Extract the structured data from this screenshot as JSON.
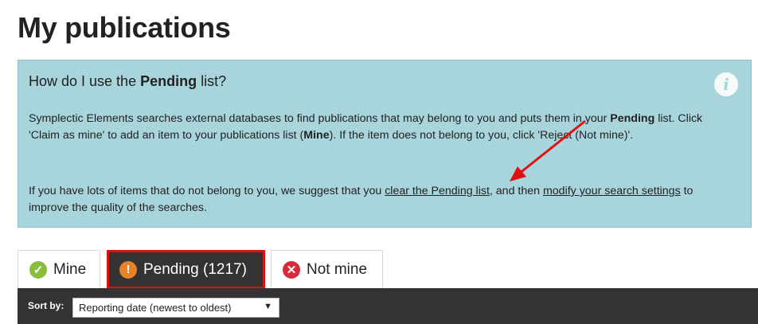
{
  "page": {
    "title": "My publications"
  },
  "help": {
    "heading_prefix": "How do I use the ",
    "heading_bold": "Pending",
    "heading_suffix": " list?",
    "p1_a": "Symplectic Elements searches external databases to find publications that may belong to you and puts them in your ",
    "p1_b_bold": "Pending",
    "p1_c": " list. Click 'Claim as mine' to add an item to your publications list (",
    "p1_d_bold": "Mine",
    "p1_e": "). If the item does not belong to you, click 'Reject (Not mine)'.",
    "p2_a": "If you have lots of items that do not belong to you, we suggest that you ",
    "p2_link1": "clear the Pending list",
    "p2_b": ", and then ",
    "p2_link2": "modify your search settings",
    "p2_c": " to improve the quality of the searches."
  },
  "tabs": [
    {
      "label": "Mine",
      "icon": "check-circle-icon"
    },
    {
      "label": "Pending (1217)",
      "icon": "exclamation-circle-icon",
      "active": true
    },
    {
      "label": "Not mine",
      "icon": "x-circle-icon"
    }
  ],
  "toolbar": {
    "sort_label": "Sort by:",
    "sort_value": "Reporting date (newest to oldest)"
  },
  "colors": {
    "help_bg": "#a8d4dc",
    "toolbar_bg": "#333333",
    "highlight": "#e01010",
    "mine_icon": "#8bbd3c",
    "pending_icon": "#e8822a",
    "notmine_icon": "#d8283a"
  }
}
